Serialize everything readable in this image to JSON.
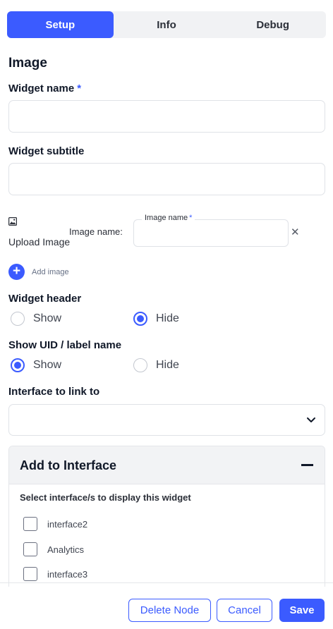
{
  "tabs": {
    "setup": "Setup",
    "info": "Info",
    "debug": "Debug"
  },
  "section_title": "Image",
  "widget_name": {
    "label": "Widget name",
    "required_mark": "*",
    "value": ""
  },
  "widget_subtitle": {
    "label": "Widget subtitle",
    "value": ""
  },
  "upload": {
    "icon": "image-icon",
    "label": "Upload Image"
  },
  "image_name": {
    "row_label": "Image name:",
    "field_label": "Image name",
    "required_mark": "*",
    "remove": "✕"
  },
  "add_image": {
    "plus": "+",
    "label": "Add image"
  },
  "widget_header": {
    "label": "Widget header",
    "options": [
      "Show",
      "Hide"
    ],
    "selected": "Hide"
  },
  "show_uid": {
    "label": "Show UID / label name",
    "options": [
      "Show",
      "Hide"
    ],
    "selected": "Show"
  },
  "interface_link": {
    "label": "Interface to link to",
    "value": ""
  },
  "add_to_interface": {
    "title": "Add to Interface",
    "select_label": "Select interface/s to display this widget",
    "items": [
      "interface2",
      "Analytics",
      "interface3"
    ]
  },
  "footer": {
    "delete": "Delete Node",
    "cancel": "Cancel",
    "save": "Save"
  },
  "colors": {
    "accent": "#3b5bff",
    "text": "#101828",
    "border": "#dfe2e7"
  }
}
